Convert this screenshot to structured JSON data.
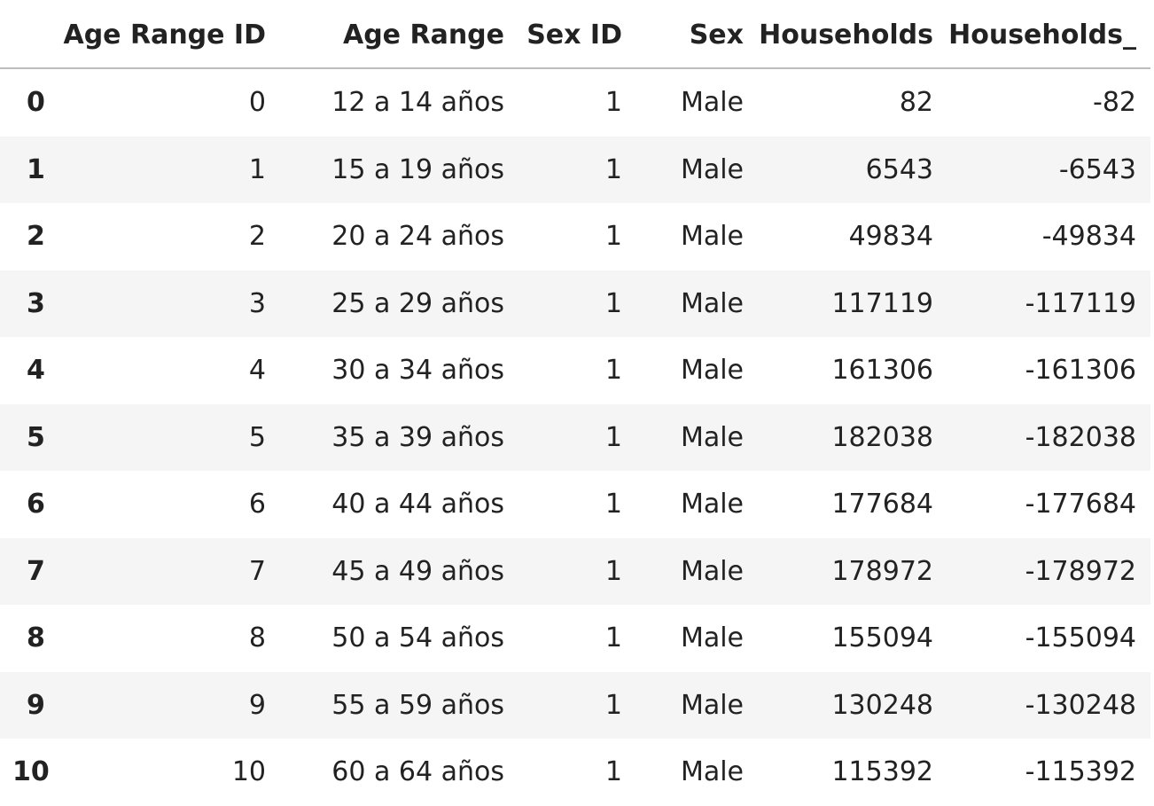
{
  "table": {
    "columns": [
      "",
      "Age Range ID",
      "Age Range",
      "Sex ID",
      "Sex",
      "Households",
      "Households_"
    ],
    "rows": [
      {
        "index": "0",
        "age_range_id": "0",
        "age_range": "12 a 14 años",
        "sex_id": "1",
        "sex": "Male",
        "households": "82",
        "households_": "-82"
      },
      {
        "index": "1",
        "age_range_id": "1",
        "age_range": "15 a 19 años",
        "sex_id": "1",
        "sex": "Male",
        "households": "6543",
        "households_": "-6543"
      },
      {
        "index": "2",
        "age_range_id": "2",
        "age_range": "20 a 24 años",
        "sex_id": "1",
        "sex": "Male",
        "households": "49834",
        "households_": "-49834"
      },
      {
        "index": "3",
        "age_range_id": "3",
        "age_range": "25 a 29 años",
        "sex_id": "1",
        "sex": "Male",
        "households": "117119",
        "households_": "-117119"
      },
      {
        "index": "4",
        "age_range_id": "4",
        "age_range": "30 a 34 años",
        "sex_id": "1",
        "sex": "Male",
        "households": "161306",
        "households_": "-161306"
      },
      {
        "index": "5",
        "age_range_id": "5",
        "age_range": "35 a 39 años",
        "sex_id": "1",
        "sex": "Male",
        "households": "182038",
        "households_": "-182038"
      },
      {
        "index": "6",
        "age_range_id": "6",
        "age_range": "40 a 44 años",
        "sex_id": "1",
        "sex": "Male",
        "households": "177684",
        "households_": "-177684"
      },
      {
        "index": "7",
        "age_range_id": "7",
        "age_range": "45 a 49 años",
        "sex_id": "1",
        "sex": "Male",
        "households": "178972",
        "households_": "-178972"
      },
      {
        "index": "8",
        "age_range_id": "8",
        "age_range": "50 a 54 años",
        "sex_id": "1",
        "sex": "Male",
        "households": "155094",
        "households_": "-155094"
      },
      {
        "index": "9",
        "age_range_id": "9",
        "age_range": "55 a 59 años",
        "sex_id": "1",
        "sex": "Male",
        "households": "130248",
        "households_": "-130248"
      },
      {
        "index": "10",
        "age_range_id": "10",
        "age_range": "60 a 64 años",
        "sex_id": "1",
        "sex": "Male",
        "households": "115392",
        "households_": "-115392"
      }
    ]
  },
  "colors": {
    "stripe": "#f5f5f5",
    "header_rule": "#bdbdbd",
    "text": "#222222"
  }
}
